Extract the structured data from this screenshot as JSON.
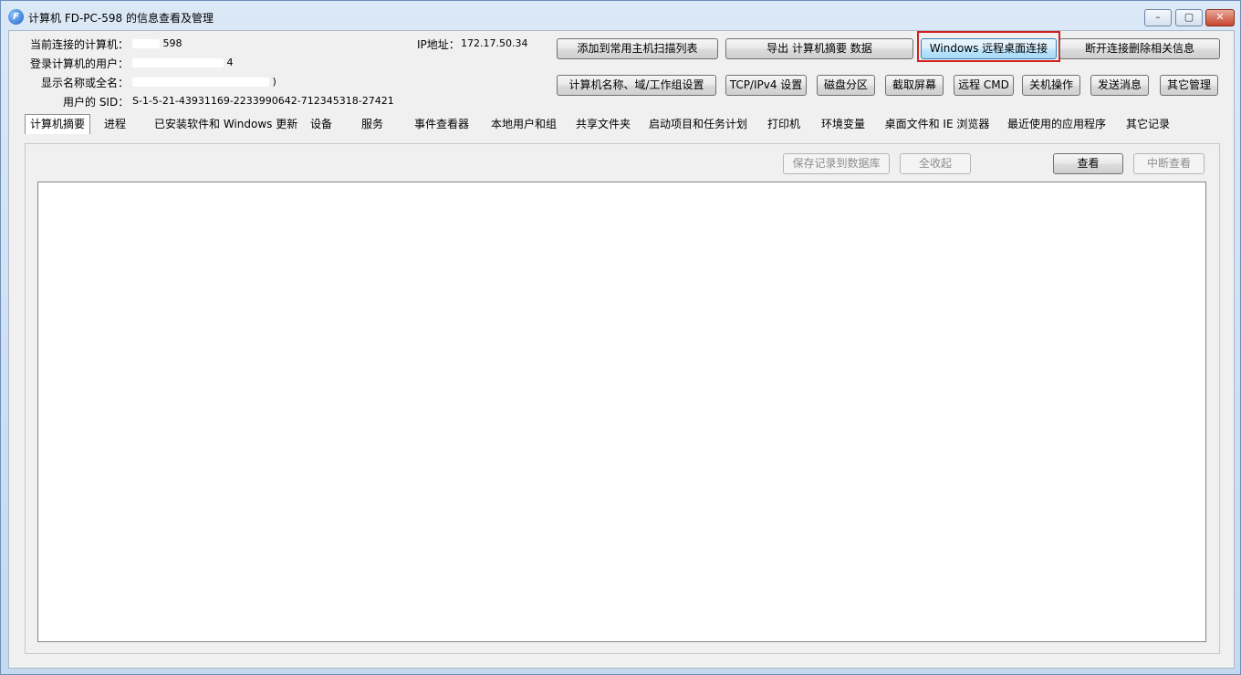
{
  "window": {
    "title": "计算机 FD-PC-598 的信息查看及管理",
    "icon_symbol": "F",
    "min_symbol": "–",
    "max_symbol": "▢",
    "close_symbol": "✕"
  },
  "info": {
    "computer_label": "当前连接的计算机：",
    "computer_value": "598",
    "user_label": "登录计算机的用户：",
    "user_value": "4",
    "display_label": "显示名称或全名：",
    "display_value": ")",
    "sid_label": "用户的 SID：",
    "sid_value": "S-1-5-21-43931169-2233990642-712345318-27421",
    "ip_label": "IP地址：",
    "ip_value": "172.17.50.34"
  },
  "toolbar": {
    "add_scan_list": "添加到常用主机扫描列表",
    "export_summary": "导出 计算机摘要 数据",
    "remote_desktop": "Windows 远程桌面连接",
    "disconnect_delete": "断开连接删除相关信息",
    "name_domain_settings": "计算机名称、域/工作组设置",
    "tcpip_settings": "TCP/IPv4 设置",
    "disk_partition": "磁盘分区",
    "screenshot": "截取屏幕",
    "remote_cmd": "远程 CMD",
    "shutdown": "关机操作",
    "send_message": "发送消息",
    "other_management": "其它管理"
  },
  "tabs": [
    "计算机摘要",
    "进程",
    "已安装软件和 Windows 更新",
    "设备",
    "服务",
    "事件查看器",
    "本地用户和组",
    "共享文件夹",
    "启动项目和任务计划",
    "打印机",
    "环境变量",
    "桌面文件和 IE 浏览器",
    "最近使用的应用程序",
    "其它记录"
  ],
  "panel": {
    "save_to_db": "保存记录到数据库",
    "collapse_all": "全收起",
    "view": "查看",
    "stop_view": "中断查看"
  }
}
